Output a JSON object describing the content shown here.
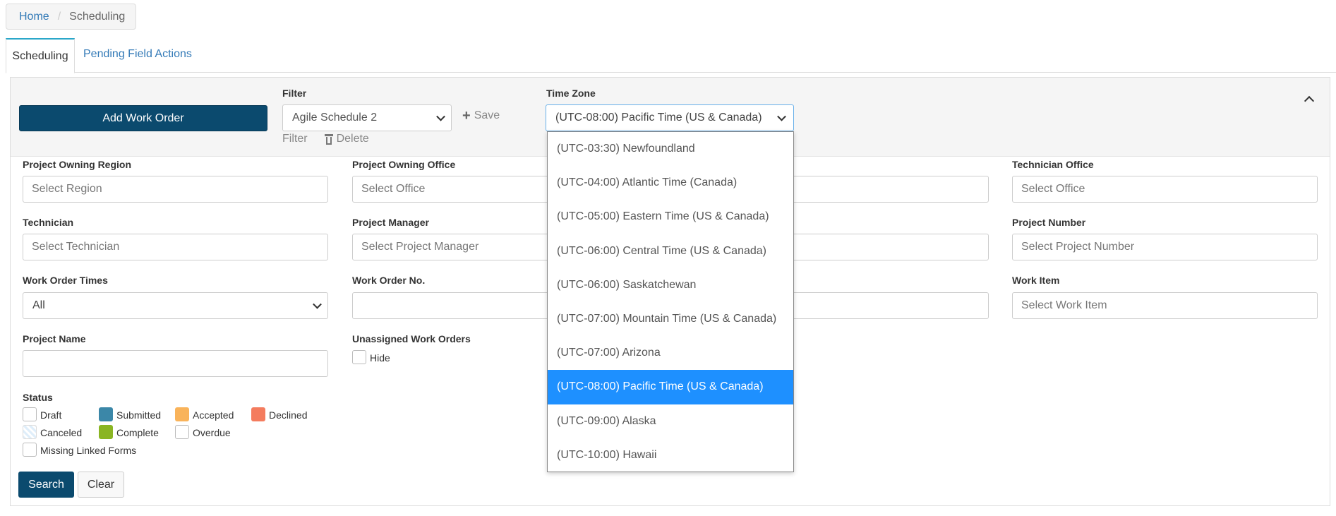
{
  "breadcrumb": {
    "home": "Home",
    "separator": "/",
    "current": "Scheduling"
  },
  "tabs": [
    {
      "label": "Scheduling",
      "active": true
    },
    {
      "label": "Pending Field Actions",
      "active": false
    }
  ],
  "header": {
    "add_work_order": "Add Work Order",
    "filter_label": "Filter",
    "filter_value": "Agile Schedule 2",
    "save": "Save",
    "filter_link": "Filter",
    "delete": "Delete",
    "timezone_label": "Time Zone",
    "timezone_value": "(UTC-08:00) Pacific Time (US & Canada)"
  },
  "timezone_options": [
    "(UTC-03:30) Newfoundland",
    "(UTC-04:00) Atlantic Time (Canada)",
    "(UTC-05:00) Eastern Time (US & Canada)",
    "(UTC-06:00) Central Time (US & Canada)",
    "(UTC-06:00) Saskatchewan",
    "(UTC-07:00) Mountain Time (US & Canada)",
    "(UTC-07:00) Arizona",
    "(UTC-08:00) Pacific Time (US & Canada)",
    "(UTC-09:00) Alaska",
    "(UTC-10:00) Hawaii"
  ],
  "fields": {
    "project_owning_region": {
      "label": "Project Owning Region",
      "placeholder": "Select Region"
    },
    "project_owning_office": {
      "label": "Project Owning Office",
      "placeholder": "Select Office"
    },
    "technician_office": {
      "label": "Technician Office",
      "placeholder": "Select Office"
    },
    "technician": {
      "label": "Technician",
      "placeholder": "Select Technician"
    },
    "project_manager": {
      "label": "Project Manager",
      "placeholder": "Select Project Manager"
    },
    "project_number": {
      "label": "Project Number",
      "placeholder": "Select Project Number"
    },
    "work_order_times": {
      "label": "Work Order Times",
      "value": "All"
    },
    "work_order_no": {
      "label": "Work Order No.",
      "value": ""
    },
    "work_item": {
      "label": "Work Item",
      "placeholder": "Select Work Item"
    },
    "project_name": {
      "label": "Project Name",
      "value": ""
    },
    "unassigned": {
      "label": "Unassigned Work Orders",
      "hide": "Hide"
    }
  },
  "status": {
    "label": "Status",
    "items": {
      "draft": "Draft",
      "submitted": "Submitted",
      "accepted": "Accepted",
      "declined": "Declined",
      "canceled": "Canceled",
      "complete": "Complete",
      "overdue": "Overdue",
      "missing_linked_forms": "Missing Linked Forms"
    },
    "colors": {
      "submitted": "#3b87a8",
      "accepted": "#f9b35a",
      "declined": "#f47c5e",
      "complete": "#8ab523"
    }
  },
  "buttons": {
    "search": "Search",
    "clear": "Clear"
  }
}
